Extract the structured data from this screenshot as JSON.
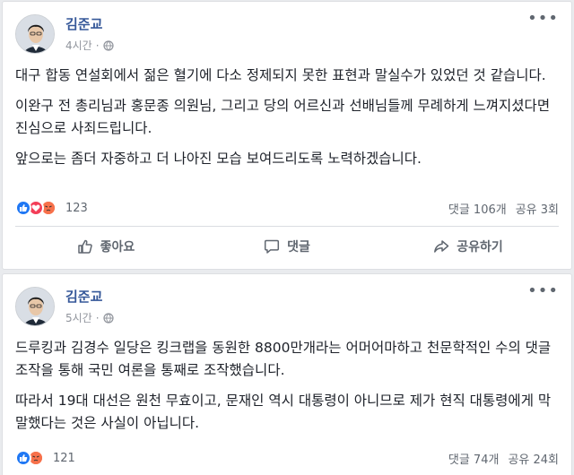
{
  "posts": [
    {
      "author": "김준교",
      "time": "4시간",
      "paragraphs": [
        "대구 합동 연설회에서 젊은 혈기에 다소 정제되지 못한 표현과 말실수가 있었던 것 같습니다.",
        "이완구 전 총리님과 홍문종 의원님, 그리고 당의 어르신과 선배님들께 무례하게 느껴지셨다면 진심으로 사죄드립니다.",
        "앞으로는 좀더 자중하고 더 나아진 모습 보여드리도록 노력하겠습니다."
      ],
      "reaction_count": "123",
      "comments": "댓글 106개",
      "shares": "공유 3회",
      "actions": {
        "like": "좋아요",
        "comment": "댓글",
        "share": "공유하기"
      }
    },
    {
      "author": "김준교",
      "time": "5시간",
      "paragraphs": [
        "드루킹과 김경수 일당은 킹크랩을 동원한 8800만개라는 어머어마하고 천문학적인 수의 댓글 조작을 통해 국민 여론을 통째로 조작했습니다.",
        "따라서 19대 대선은 원천 무효이고, 문재인 역시 대통령이 아니므로 제가 현직 대통령에게 막말했다는 것은 사실이 아닙니다."
      ],
      "reaction_count": "121",
      "comments": "댓글 74개",
      "shares": "공유 24회"
    }
  ]
}
